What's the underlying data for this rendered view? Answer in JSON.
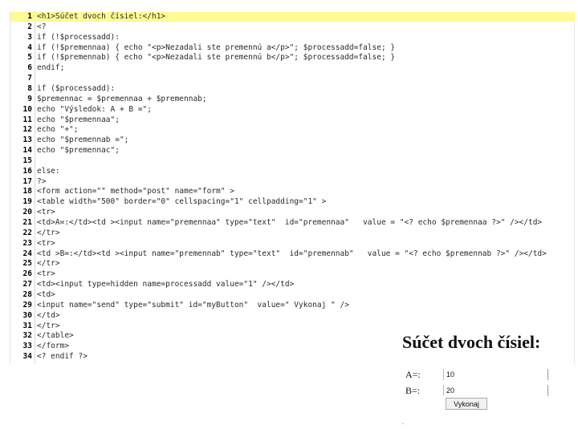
{
  "editor": {
    "lines": [
      {
        "n": "1",
        "text": "<h1>Súčet dvoch čísiel:</h1>"
      },
      {
        "n": "2",
        "text": "<?"
      },
      {
        "n": "3",
        "text": "if (!$processadd):"
      },
      {
        "n": "4",
        "text": "if (!$premennaa) { echo \"<p>Nezadali ste premennú a</p>\"; $processadd=false; }"
      },
      {
        "n": "5",
        "text": "if (!$premennab) { echo \"<p>Nezadali ste premennú b</p>\"; $processadd=false; }"
      },
      {
        "n": "6",
        "text": "endif;"
      },
      {
        "n": "7",
        "text": ""
      },
      {
        "n": "8",
        "text": "if ($processadd):"
      },
      {
        "n": "9",
        "text": "$premennac = $premennaa + $premennab;"
      },
      {
        "n": "10",
        "text": "echo \"Výsledok: A + B =\";"
      },
      {
        "n": "11",
        "text": "echo \"$premennaa\";"
      },
      {
        "n": "12",
        "text": "echo \"+\";"
      },
      {
        "n": "13",
        "text": "echo \"$premennab =\";"
      },
      {
        "n": "14",
        "text": "echo \"$premennac\";"
      },
      {
        "n": "15",
        "text": ""
      },
      {
        "n": "16",
        "text": "else:"
      },
      {
        "n": "17",
        "text": "?>"
      },
      {
        "n": "18",
        "text": "<form action=\"\" method=\"post\" name=\"form\" >"
      },
      {
        "n": "19",
        "text": "<table width=\"500\" border=\"0\" cellspacing=\"1\" cellpadding=\"1\" >"
      },
      {
        "n": "20",
        "text": "<tr>"
      },
      {
        "n": "21",
        "text": "<td>A=:</td><td ><input name=\"premennaa\" type=\"text\"  id=\"premennaa\"   value = \"<? echo $premennaa ?>\" /></td>"
      },
      {
        "n": "22",
        "text": "</tr>"
      },
      {
        "n": "23",
        "text": "<tr>"
      },
      {
        "n": "24",
        "text": "<td >B=:</td><td ><input name=\"premennab\" type=\"text\"  id=\"premennab\"   value = \"<? echo $premennab ?>\" /></td>"
      },
      {
        "n": "25",
        "text": "</tr>"
      },
      {
        "n": "26",
        "text": "<tr>"
      },
      {
        "n": "27",
        "text": "<td><input type=hidden name=processadd value=\"1\" /></td>"
      },
      {
        "n": "28",
        "text": "<td>"
      },
      {
        "n": "29",
        "text": "<input name=\"send\" type=\"submit\" id=\"myButton\"  value=\" Vykonaj \" />"
      },
      {
        "n": "30",
        "text": "</td>"
      },
      {
        "n": "31",
        "text": "</tr>"
      },
      {
        "n": "32",
        "text": "</table>"
      },
      {
        "n": "33",
        "text": "</form>"
      },
      {
        "n": "34",
        "text": "<? endif ?>"
      }
    ]
  },
  "preview": {
    "title": "Súčet dvoch čísiel:",
    "label_a": "A=:",
    "value_a": "10",
    "label_b": "B=:",
    "value_b": "20",
    "button": "Vykonaj",
    "dot": "."
  },
  "colors": {
    "highlight": "#fffb94"
  }
}
